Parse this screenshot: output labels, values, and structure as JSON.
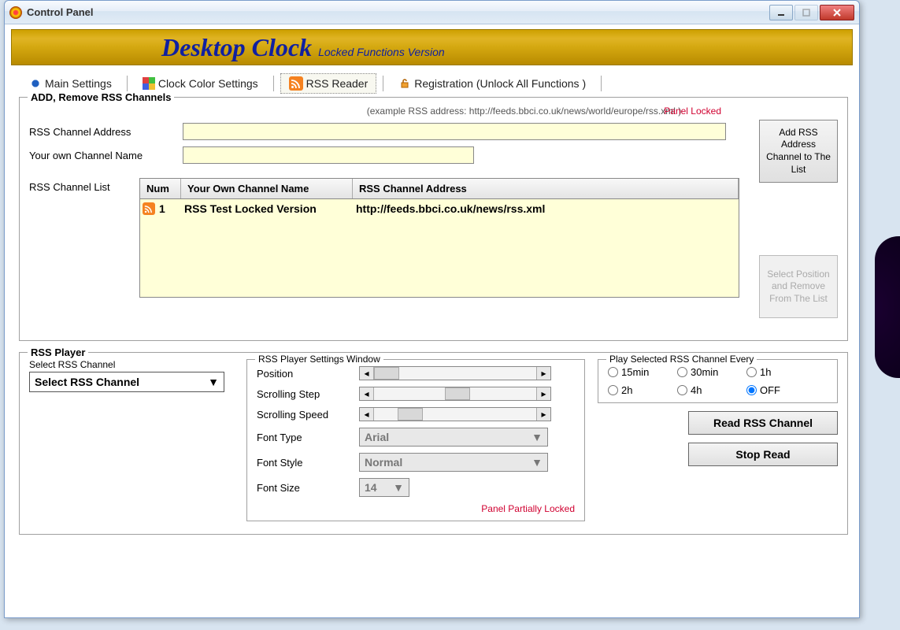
{
  "window": {
    "title": "Control Panel"
  },
  "banner": {
    "title": "Desktop Clock",
    "subtitle": "Locked Functions Version"
  },
  "tabs": {
    "main": "Main Settings",
    "color": "Clock Color Settings",
    "rss": "RSS Reader",
    "reg": "Registration  (Unlock All Functions )"
  },
  "add_section": {
    "legend": "ADD, Remove RSS Channels",
    "example": "(example RSS address:  http://feeds.bbci.co.uk/news/world/europe/rss.xml )",
    "locked": "Panel Locked",
    "addr_label": "RSS Channel Address",
    "name_label": "Your own Channel Name",
    "list_label": "RSS Channel List",
    "add_btn": "Add RSS Address Channel to The List",
    "remove_btn": "Select Position and Remove From The List",
    "headers": {
      "num": "Num",
      "name": "Your Own Channel Name",
      "addr": "RSS Channel Address"
    },
    "rows": [
      {
        "num": "1",
        "name": "RSS Test Locked Version",
        "addr": "http://feeds.bbci.co.uk/news/rss.xml"
      }
    ]
  },
  "player": {
    "legend": "RSS Player",
    "select_label": "Select RSS Channel",
    "select_value": "Select RSS Channel",
    "settings_legend": "RSS Player Settings Window",
    "position": "Position",
    "scroll_step": "Scrolling Step",
    "scroll_speed": "Scrolling Speed",
    "font_type_label": "Font Type",
    "font_type_value": "Arial",
    "font_style_label": "Font Style",
    "font_style_value": "Normal",
    "font_size_label": "Font Size",
    "font_size_value": "14",
    "interval_legend": "Play Selected RSS Channel Every",
    "intervals": {
      "i15": "15min",
      "i30": "30min",
      "i1h": "1h",
      "i2h": "2h",
      "i4h": "4h",
      "off": "OFF"
    },
    "read_btn": "Read RSS Channel",
    "stop_btn": "Stop Read",
    "locked": "Panel Partially Locked"
  }
}
